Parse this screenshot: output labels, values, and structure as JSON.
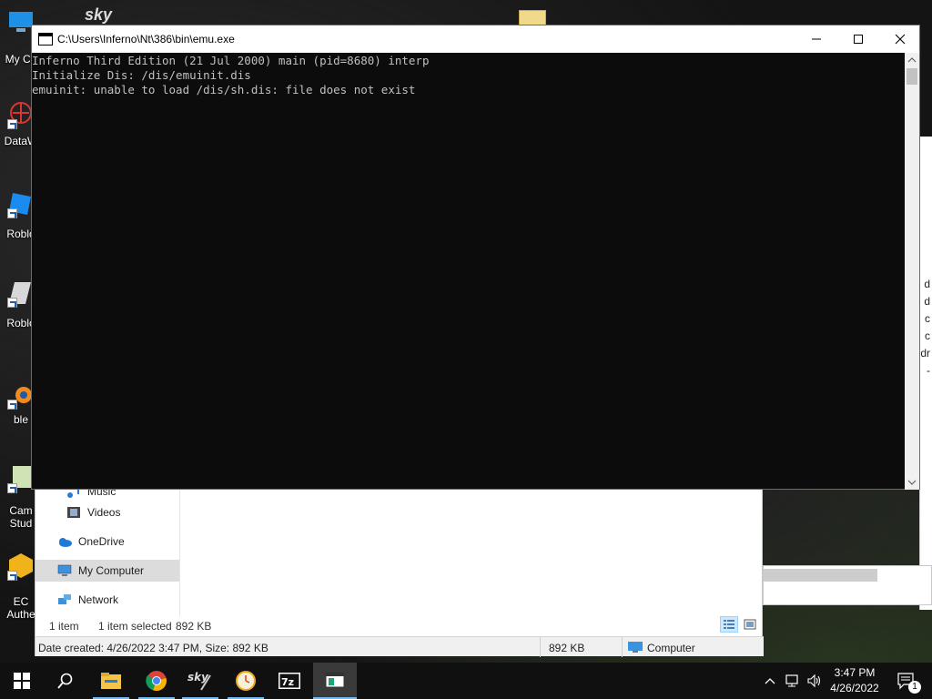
{
  "console": {
    "title": "C:\\Users\\Inferno\\Nt\\386\\bin\\emu.exe",
    "lines": [
      "Inferno Third Edition (21 Jul 2000) main (pid=8680) interp",
      "Initialize Dis: /dis/emuinit.dis",
      "emuinit: unable to load /dis/sh.dis: file does not exist"
    ]
  },
  "desktop_icons": [
    {
      "label": "My Co",
      "icon": "computer-icon"
    },
    {
      "label": "DataW",
      "icon": "datawrite-icon"
    },
    {
      "label": "Roblo",
      "icon": "roblox-icon"
    },
    {
      "label": "Roblo",
      "icon": "roblox-studio-icon"
    },
    {
      "label": "ble",
      "icon": "blender-icon"
    },
    {
      "label": "Cam",
      "label2": "Stud",
      "icon": "camtasia-icon"
    },
    {
      "label": "EC",
      "label2": "Authe",
      "icon": "ec-authenticator-icon"
    }
  ],
  "explorer": {
    "nav_items": [
      {
        "label": "Music",
        "icon": "music-icon"
      },
      {
        "label": "Videos",
        "icon": "videos-icon"
      },
      {
        "label": "OneDrive",
        "icon": "onedrive-icon"
      },
      {
        "label": "My Computer",
        "icon": "computer-icon",
        "selected": true
      },
      {
        "label": "Network",
        "icon": "network-icon"
      }
    ],
    "status_count": "1 item",
    "status_selected": "1 item selected",
    "status_size": "892 KB",
    "details_text": "Date created: 4/26/2022 3:47 PM, Size: 892 KB",
    "details_size": "892 KB",
    "details_location": "Computer"
  },
  "right_partial_text": [
    "d",
    "d",
    "c",
    "c",
    "dr",
    "-"
  ],
  "taskbar": {
    "apps": [
      "start-icon",
      "search-icon",
      "file-explorer-icon",
      "chrome-icon",
      "sky-icon",
      "clock-app-icon",
      "7zip-icon",
      "emu-console-icon"
    ],
    "time": "3:47 PM",
    "date": "4/26/2022",
    "notification_count": "1"
  },
  "colors": {
    "console_bg": "#0c0c0c",
    "console_text": "#c0c0c0",
    "taskbar_bg": "#101010",
    "accent": "#76b9ed"
  }
}
